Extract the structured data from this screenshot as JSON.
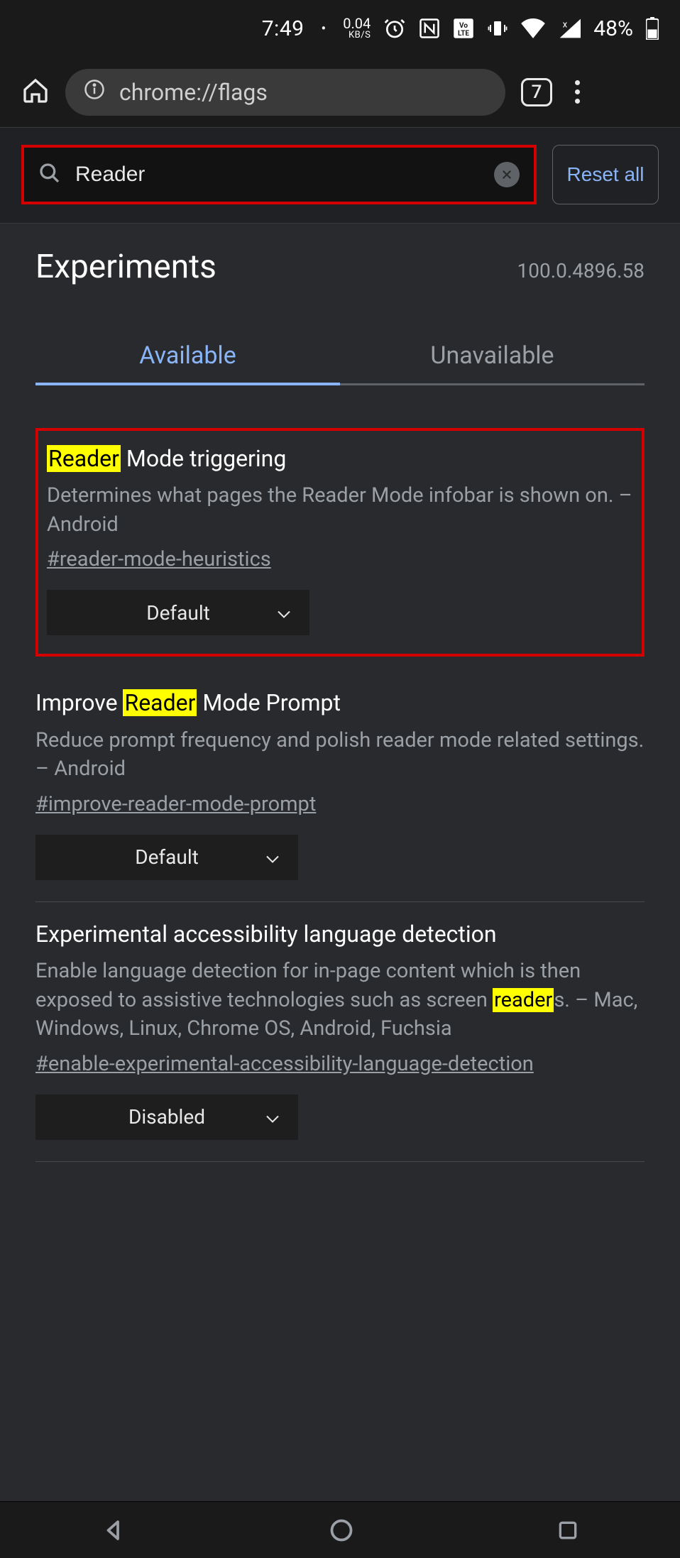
{
  "status": {
    "time": "7:49",
    "net_speed_value": "0.04",
    "net_speed_unit": "KB/S",
    "battery_pct": "48%"
  },
  "browser": {
    "url": "chrome://flags",
    "tab_count": "7"
  },
  "flags": {
    "search_value": "Reader",
    "reset_label": "Reset all",
    "title": "Experiments",
    "version": "100.0.4896.58",
    "tabs": {
      "available": "Available",
      "unavailable": "Unavailable"
    },
    "items": [
      {
        "title_pre": "",
        "title_hl": "Reader",
        "title_post": " Mode triggering",
        "desc": "Determines what pages the Reader Mode infobar is shown on. – Android",
        "anchor": "#reader-mode-heuristics",
        "select": "Default"
      },
      {
        "title_pre": "Improve ",
        "title_hl": "Reader",
        "title_post": " Mode Prompt",
        "desc": "Reduce prompt frequency and polish reader mode related settings. – Android",
        "anchor": "#improve-reader-mode-prompt",
        "select": "Default"
      },
      {
        "title_pre": "Experimental accessibility language detection",
        "title_hl": "",
        "title_post": "",
        "desc_pre": "Enable language detection for in-page content which is then exposed to assistive technologies such as screen ",
        "desc_hl": "reader",
        "desc_post": "s. – Mac, Windows, Linux, Chrome OS, Android, Fuchsia",
        "anchor": "#enable-experimental-accessibility-language-detection",
        "select": "Disabled"
      }
    ]
  }
}
